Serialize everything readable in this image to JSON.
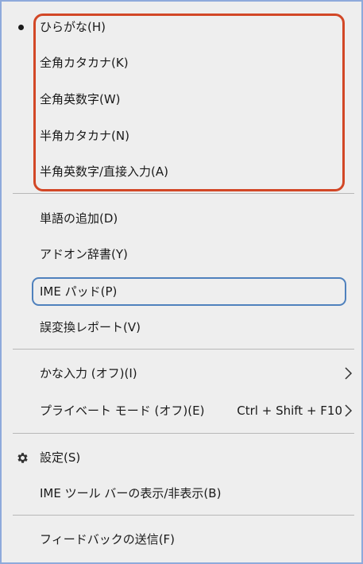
{
  "menu": {
    "input_modes": [
      {
        "label": "ひらがな(H)",
        "selected": true
      },
      {
        "label": "全角カタカナ(K)",
        "selected": false
      },
      {
        "label": "全角英数字(W)",
        "selected": false
      },
      {
        "label": "半角カタカナ(N)",
        "selected": false
      },
      {
        "label": "半角英数字/直接入力(A)",
        "selected": false
      }
    ],
    "tools": [
      {
        "label": "単語の追加(D)"
      },
      {
        "label": "アドオン辞書(Y)"
      },
      {
        "label": "IME パッド(P)"
      },
      {
        "label": "誤変換レポート(V)"
      }
    ],
    "options": [
      {
        "label": "かな入力 (オフ)(I)",
        "shortcut": "",
        "has_submenu": true
      },
      {
        "label": "プライベート モード (オフ)(E)",
        "shortcut": "Ctrl + Shift + F10",
        "has_submenu": true
      }
    ],
    "settings": [
      {
        "label": "設定(S)",
        "icon": "gear-icon"
      },
      {
        "label": "IME ツール バーの表示/非表示(B)"
      }
    ],
    "feedback": [
      {
        "label": "フィードバックの送信(F)"
      }
    ]
  },
  "colors": {
    "background": "#eeeeee",
    "window_border": "#8eaadb",
    "highlight_red": "#d24726",
    "highlight_blue": "#4f81bd",
    "text": "#1a1a1a",
    "separator": "#b8b8b8"
  }
}
